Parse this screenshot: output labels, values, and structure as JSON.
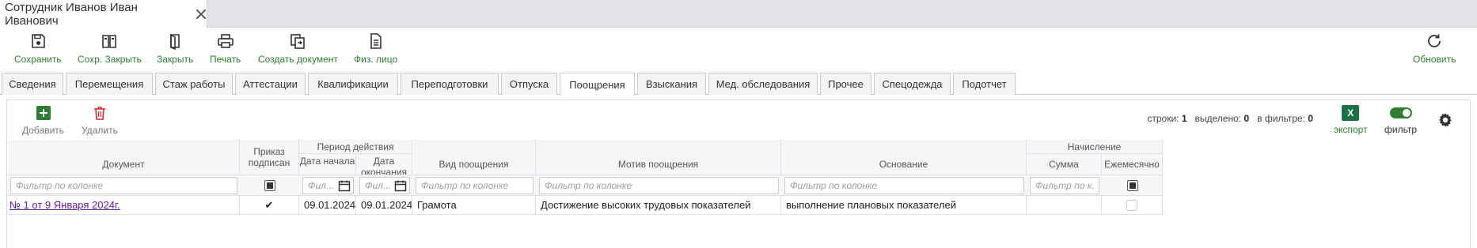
{
  "window": {
    "tab_title": "Сотрудник Иванов Иван Иванович"
  },
  "toolbar": {
    "save": "Сохранить",
    "save_close": "Сохр. Закрыть",
    "close": "Закрыть",
    "print": "Печать",
    "create_doc": "Создать документ",
    "person": "Физ. лицо",
    "refresh": "Обновить"
  },
  "tabs": [
    {
      "label": "Сведения"
    },
    {
      "label": "Перемещения"
    },
    {
      "label": "Стаж работы"
    },
    {
      "label": "Аттестации"
    },
    {
      "label": "Квалификации"
    },
    {
      "label": "Переподготовки"
    },
    {
      "label": "Отпуска"
    },
    {
      "label": "Поощрения",
      "active": true
    },
    {
      "label": "Взыскания"
    },
    {
      "label": "Мед. обследования"
    },
    {
      "label": "Прочее"
    },
    {
      "label": "Спецодежда"
    },
    {
      "label": "Подотчет"
    }
  ],
  "grid_toolbar": {
    "add": "Добавить",
    "delete": "Удалить",
    "rows_label": "строки:",
    "rows_value": "1",
    "selected_label": "выделено:",
    "selected_value": "0",
    "filtered_label": "в фильтре:",
    "filtered_value": "0",
    "export": "экспорт",
    "export_icon_text": "X",
    "filter": "фильтр"
  },
  "columns": {
    "document": "Документ",
    "order_signed": "Приказ подписан",
    "period": "Период действия",
    "date_start": "Дата начала",
    "date_end": "Дата окончания",
    "award_type": "Вид поощрения",
    "award_reason": "Мотив поощрения",
    "basis": "Основание",
    "accrual": "Начисление",
    "amount": "Сумма",
    "monthly": "Ежемесячно"
  },
  "filters": {
    "placeholder": "Фильтр по колонке",
    "date_placeholder": "Фил...",
    "amount_placeholder": "Фильтр по к..."
  },
  "rows": [
    {
      "document": "№ 1 от 9 Января 2024г.",
      "order_signed": true,
      "date_start": "09.01.2024",
      "date_end": "09.01.2024",
      "award_type": "Грамота",
      "award_reason": "Достижение высоких трудовых показателей",
      "basis": "выполнение плановых показателей",
      "amount": "",
      "monthly": false
    }
  ],
  "colors": {
    "accent_green": "#2e7d32",
    "delete_red": "#d32f2f",
    "link_purple": "#6a1b9a"
  },
  "icons": {
    "save": "floppy-disk-icon",
    "save_close": "book-save-icon",
    "close": "door-icon",
    "print": "printer-icon",
    "create_doc": "copy-document-icon",
    "person": "document-icon",
    "refresh": "refresh-icon",
    "add": "plus-icon",
    "delete": "trash-icon",
    "export": "excel-icon",
    "settings": "gear-icon"
  }
}
